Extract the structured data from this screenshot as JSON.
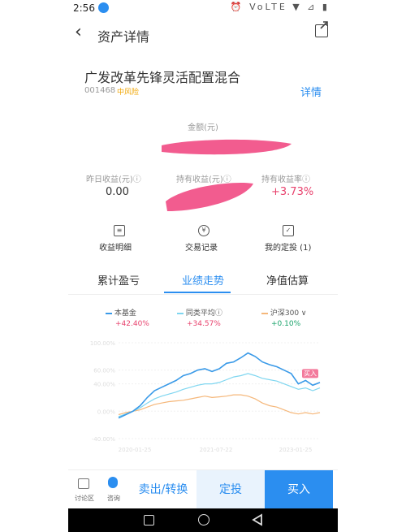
{
  "status": {
    "time": "2:56",
    "icons": "⏰ VoLTE ▼ ⊿ ▮"
  },
  "header": {
    "title": "资产详情"
  },
  "fund": {
    "name": "广发改革先锋灵活配置混合",
    "code": "001468",
    "risk": "中风险",
    "details_link": "详情"
  },
  "amount": {
    "label": "金额(元)"
  },
  "stats": [
    {
      "label": "昨日收益(元)ⓘ",
      "value": "0.00"
    },
    {
      "label": "持有收益(元)ⓘ",
      "value": ""
    },
    {
      "label": "持有收益率ⓘ",
      "value": "+3.73%"
    }
  ],
  "quick_actions": [
    {
      "icon": "≡",
      "label": "收益明细"
    },
    {
      "icon": "¥",
      "label": "交易记录"
    },
    {
      "icon": "✓",
      "label": "我的定投 (1)"
    }
  ],
  "tabs": [
    "累计盈亏",
    "业绩走势",
    "净值估算"
  ],
  "legend": [
    {
      "name": "本基金",
      "pct": "+42.40%",
      "color": "#3a9ae8",
      "pct_color": "#e8436e"
    },
    {
      "name": "同类平均ⓘ",
      "pct": "+34.57%",
      "color": "#7fd6f0",
      "pct_color": "#e8436e"
    },
    {
      "name": "沪深300 ∨",
      "pct": "+0.10%",
      "color": "#f5b77a",
      "pct_color": "#1aa36b"
    }
  ],
  "chart_data": {
    "type": "line",
    "y_ticks": [
      "100.00%",
      "60.00%",
      "40.00%",
      "0.00%",
      "-40.00%"
    ],
    "x_ticks": [
      "2020-01-25",
      "2021-07-22",
      "2023-01-25"
    ],
    "marker_label": "买入",
    "series": [
      {
        "name": "本基金",
        "values": [
          -10,
          -5,
          0,
          8,
          20,
          30,
          35,
          40,
          45,
          52,
          55,
          60,
          62,
          58,
          62,
          70,
          72,
          78,
          85,
          80,
          72,
          68,
          65,
          60,
          55,
          40,
          45,
          38,
          42
        ]
      },
      {
        "name": "同类平均",
        "values": [
          -8,
          -4,
          0,
          5,
          12,
          18,
          22,
          25,
          28,
          32,
          35,
          38,
          40,
          40,
          42,
          46,
          50,
          52,
          55,
          52,
          48,
          46,
          44,
          40,
          36,
          32,
          34,
          30,
          34
        ]
      },
      {
        "name": "沪深300",
        "values": [
          -5,
          -2,
          0,
          2,
          6,
          10,
          12,
          14,
          15,
          16,
          18,
          20,
          22,
          20,
          21,
          22,
          24,
          24,
          22,
          18,
          12,
          8,
          6,
          2,
          -2,
          -4,
          -2,
          -4,
          -2
        ]
      }
    ]
  },
  "bottom": {
    "forum": "讨论区",
    "consult": "咨询",
    "sell": "卖出/转换",
    "fixed": "定投",
    "buy": "买入"
  }
}
